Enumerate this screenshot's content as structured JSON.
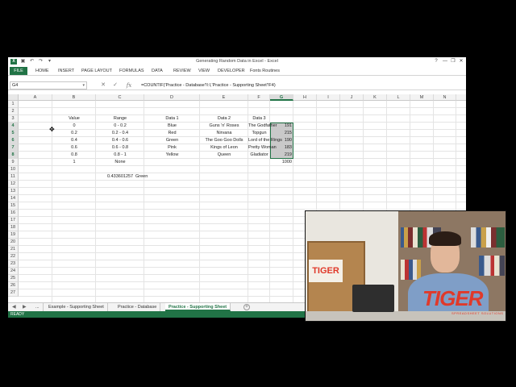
{
  "window": {
    "title": "Generating Random Data in Excel - Excel",
    "help": "?",
    "minimize": "—",
    "restore": "❐",
    "close": "✕"
  },
  "ribbon": {
    "tabs": [
      "FILE",
      "HOME",
      "INSERT",
      "PAGE LAYOUT",
      "FORMULAS",
      "DATA",
      "REVIEW",
      "VIEW",
      "DEVELOPER",
      "Fonts Routines"
    ]
  },
  "formula_bar": {
    "name_box": "G4",
    "formula": "=COUNTIF('Practice - Database'!I:I,'Practice - Supporting Sheet'!F4)"
  },
  "columns": [
    "A",
    "B",
    "C",
    "D",
    "E",
    "F",
    "G",
    "H",
    "I",
    "J",
    "K",
    "L",
    "M",
    "N",
    "O"
  ],
  "selected_column": "G",
  "rows": [
    "1",
    "2",
    "3",
    "4",
    "5",
    "6",
    "7",
    "8",
    "9",
    "10",
    "11",
    "12",
    "13",
    "14",
    "15",
    "16",
    "17",
    "18",
    "19",
    "20",
    "21",
    "22",
    "23",
    "24",
    "25",
    "26",
    "27"
  ],
  "selected_rows": [
    "4",
    "5",
    "6",
    "7",
    "8"
  ],
  "table": {
    "headers": [
      "Value",
      "Range",
      "Data 1",
      "Data 2",
      "Data 3"
    ],
    "rows": [
      [
        "0",
        "0 - 0.2",
        "Blue",
        "Guns 'n' Roses",
        "The Godfather",
        "191"
      ],
      [
        "0.2",
        "0.2 - 0.4",
        "Red",
        "Nirvana",
        "Topgun",
        "215"
      ],
      [
        "0.4",
        "0.4 - 0.6",
        "Green",
        "The Goo Goo Dolls",
        "Lord of the Rings",
        "190"
      ],
      [
        "0.6",
        "0.6 - 0.8",
        "Pink",
        "Kings of Leon",
        "Pretty Woman",
        "183"
      ],
      [
        "0.8",
        "0.8 - 1",
        "Yellow",
        "Queen",
        "Gladiator",
        "219"
      ]
    ],
    "row9": [
      "1",
      "None",
      "",
      "",
      "",
      "1000"
    ],
    "row11": [
      "0.433601257",
      "Green"
    ]
  },
  "sheet_tabs": {
    "nav_prev": "◀",
    "nav_next": "▶",
    "ellipsis": "...",
    "tabs": [
      "Example - Supporting Sheet",
      "Practice - Database",
      "Practice - Supporting Sheet"
    ],
    "active": "Practice - Supporting Sheet",
    "add": "+"
  },
  "status": {
    "text": "READY"
  },
  "video": {
    "card_text": "TIGER",
    "logo": "TIGER",
    "logo_sub": "SPREADSHEET SOLUTIONS"
  },
  "colors": {
    "excel_green": "#217346",
    "tiger_red": "#e0392a"
  }
}
